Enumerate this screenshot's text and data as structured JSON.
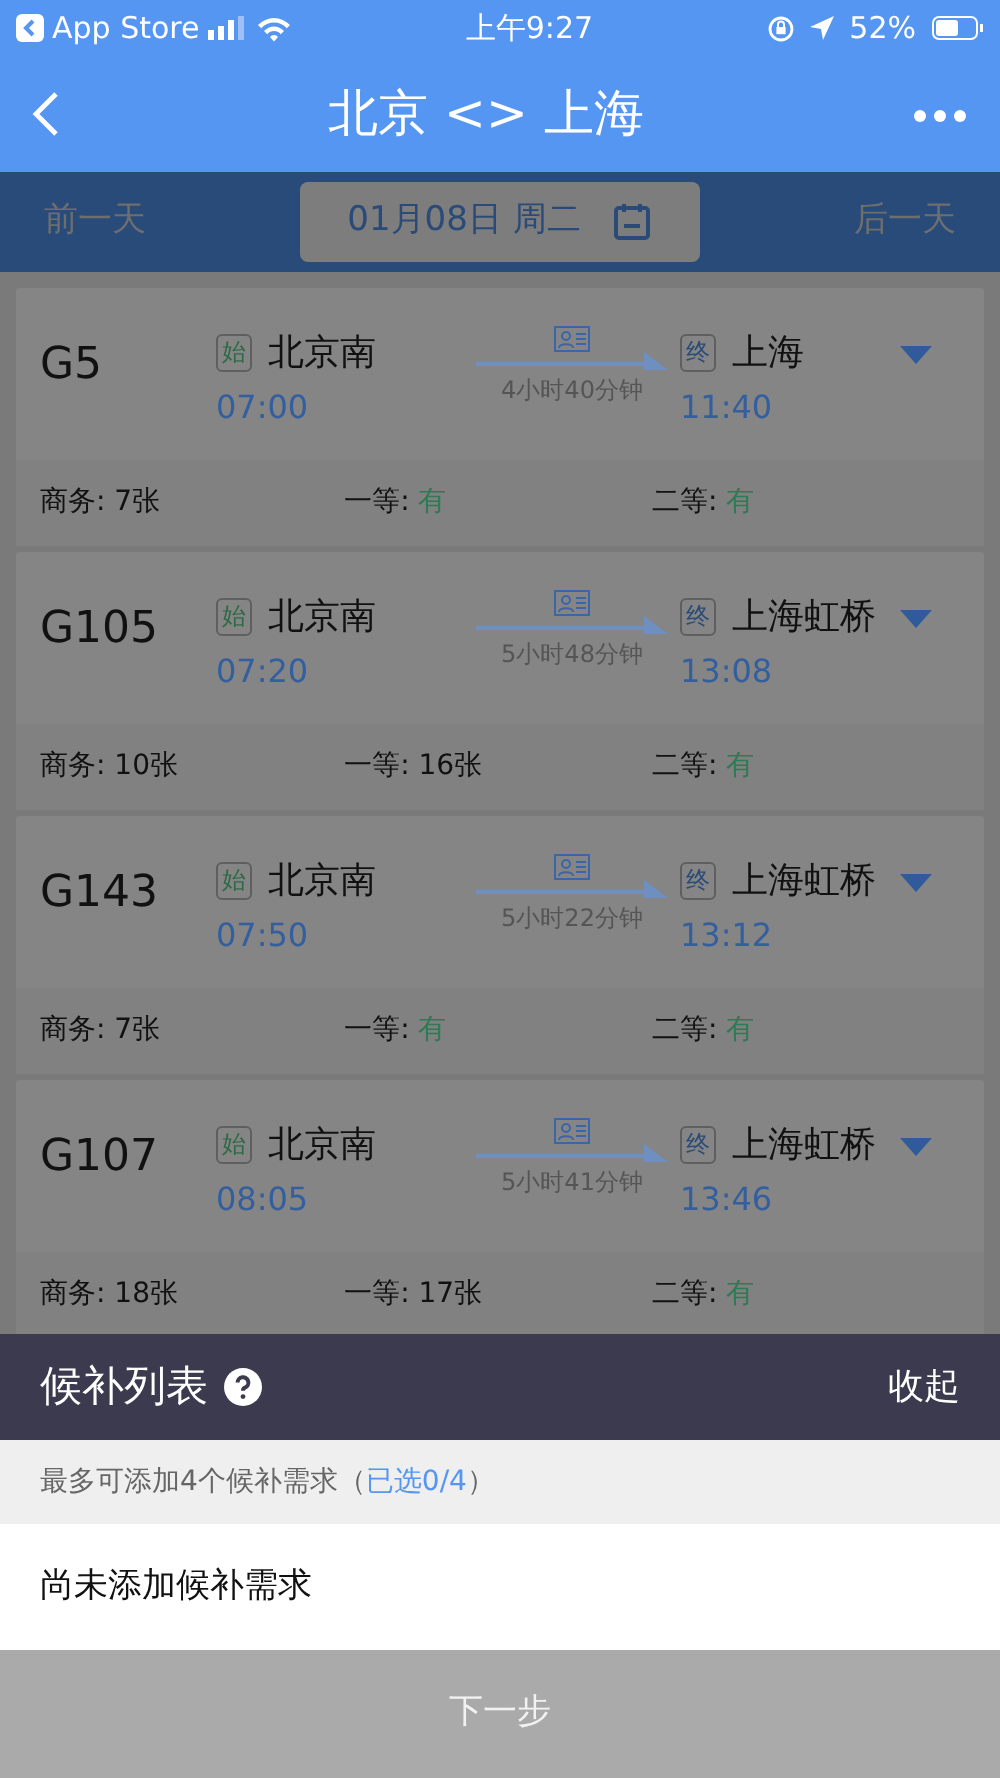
{
  "status_bar": {
    "back_app": "App Store",
    "time": "上午9:27",
    "battery": "52%"
  },
  "header": {
    "title": "北京 <> 上海"
  },
  "date_bar": {
    "prev": "前一天",
    "date": "01月08日 周二",
    "next": "后一天"
  },
  "trains": [
    {
      "number": "G5",
      "from_badge": "始",
      "from": "北京南",
      "depart": "07:00",
      "duration": "4小时40分钟",
      "to_badge": "终",
      "to": "上海",
      "arrive": "11:40",
      "seats": [
        {
          "label": "商务: ",
          "value": "7张",
          "plenty": false
        },
        {
          "label": "一等: ",
          "value": "有",
          "plenty": true
        },
        {
          "label": "二等: ",
          "value": "有",
          "plenty": true
        }
      ]
    },
    {
      "number": "G105",
      "from_badge": "始",
      "from": "北京南",
      "depart": "07:20",
      "duration": "5小时48分钟",
      "to_badge": "终",
      "to": "上海虹桥",
      "arrive": "13:08",
      "seats": [
        {
          "label": "商务: ",
          "value": "10张",
          "plenty": false
        },
        {
          "label": "一等: ",
          "value": "16张",
          "plenty": false
        },
        {
          "label": "二等: ",
          "value": "有",
          "plenty": true
        }
      ]
    },
    {
      "number": "G143",
      "from_badge": "始",
      "from": "北京南",
      "depart": "07:50",
      "duration": "5小时22分钟",
      "to_badge": "终",
      "to": "上海虹桥",
      "arrive": "13:12",
      "seats": [
        {
          "label": "商务: ",
          "value": "7张",
          "plenty": false
        },
        {
          "label": "一等: ",
          "value": "有",
          "plenty": true
        },
        {
          "label": "二等: ",
          "value": "有",
          "plenty": true
        }
      ]
    },
    {
      "number": "G107",
      "from_badge": "始",
      "from": "北京南",
      "depart": "08:05",
      "duration": "5小时41分钟",
      "to_badge": "终",
      "to": "上海虹桥",
      "arrive": "13:46",
      "seats": [
        {
          "label": "商务: ",
          "value": "18张",
          "plenty": false
        },
        {
          "label": "一等: ",
          "value": "17张",
          "plenty": false
        },
        {
          "label": "二等: ",
          "value": "有",
          "plenty": true
        }
      ]
    }
  ],
  "panel": {
    "title": "候补列表",
    "collapse": "收起",
    "note": "最多可添加4个候补需求（",
    "note_selected": "已选0/4",
    "note_end": "）",
    "empty": "尚未添加候补需求",
    "next_button": "下一步"
  }
}
